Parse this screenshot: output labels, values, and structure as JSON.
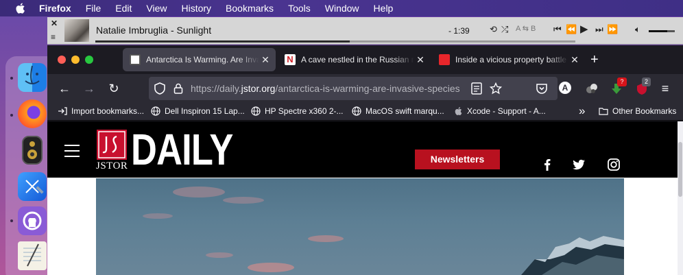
{
  "menubar": {
    "items": [
      "Firefox",
      "File",
      "Edit",
      "View",
      "History",
      "Bookmarks",
      "Tools",
      "Window",
      "Help"
    ]
  },
  "dock": {
    "apps": [
      "Finder",
      "Firefox",
      "Speaker",
      "Xcode",
      "GitHub Desktop",
      "TextEdit"
    ]
  },
  "player": {
    "close_glyph": "✕",
    "menu_glyph": "≡",
    "track": "Natalie Imbruglia - Sunlight",
    "time": "- 1:39",
    "ab_label": "A ⇆ B",
    "progress_fraction": 0.53,
    "volume_fraction": 0.72
  },
  "tabs": [
    {
      "title": "Antarctica Is Warming. Are Invasive Species",
      "active": true,
      "close": "✕"
    },
    {
      "title": "A cave nestled in the Russian mountains",
      "active": false,
      "close": "✕"
    },
    {
      "title": "Inside a vicious property battle in",
      "active": false,
      "close": "✕"
    }
  ],
  "new_tab": "+",
  "urlbar": {
    "prefix": "https://daily.",
    "host": "jstor.org",
    "path": "/antarctica-is-warming-are-invasive-species"
  },
  "toolbar": {
    "back": "←",
    "forward": "→",
    "reload": "↻",
    "extension_badge_1": "?",
    "extension_badge_2": "2",
    "menu": "≡",
    "account_letter": "A"
  },
  "bookmarks": [
    {
      "label": "Import bookmarks..."
    },
    {
      "label": "Dell Inspiron 15 Lap..."
    },
    {
      "label": "HP Spectre x360 2-..."
    },
    {
      "label": "MacOS swift marqu..."
    },
    {
      "label": "Xcode - Support - A..."
    }
  ],
  "bookmarks_overflow": "»",
  "other_bookmarks": "Other Bookmarks",
  "site": {
    "logo_sub": "JSTOR",
    "logo_word": "DAILY",
    "newsletters": "Newsletters",
    "colors": {
      "brand_red": "#b8111f",
      "header_bg": "#000000"
    }
  }
}
